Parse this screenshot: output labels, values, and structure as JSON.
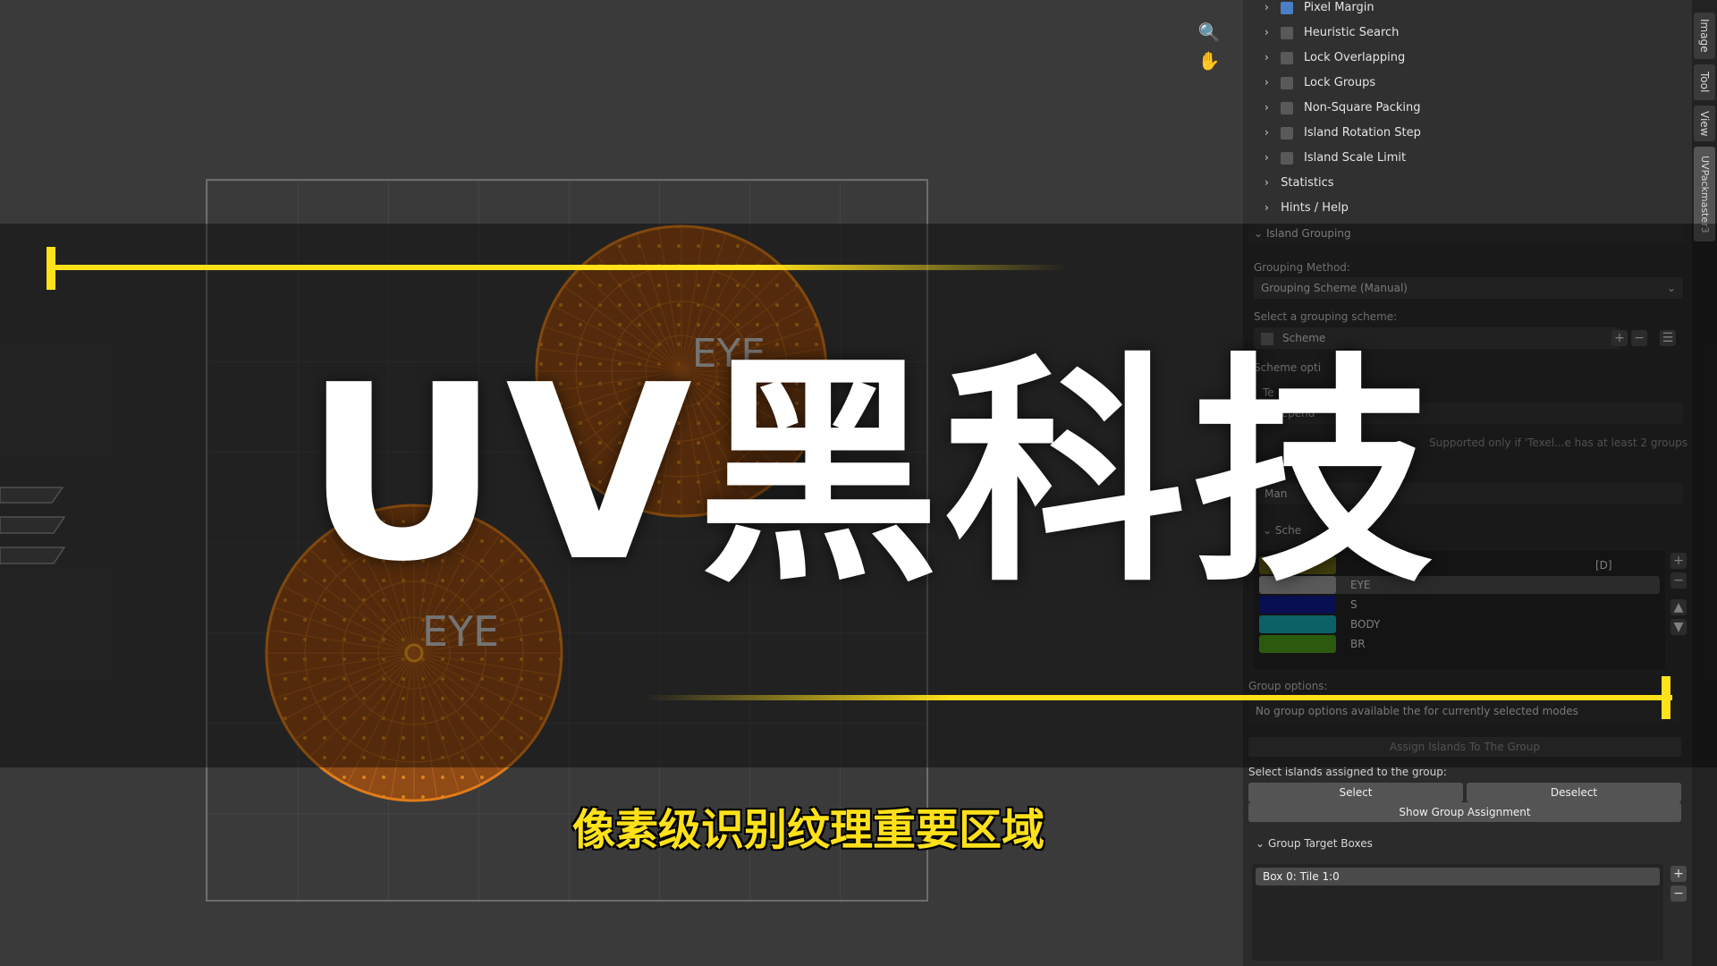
{
  "viewport": {
    "island_label_1": "EYE",
    "island_label_2": "EYE"
  },
  "overlay": {
    "title": "UV黑科技",
    "subtitle": "像素级识别纹理重要区域",
    "accent_color": "#ffe11a"
  },
  "panel": {
    "options": [
      {
        "label": "Pixel Margin",
        "checked": true
      },
      {
        "label": "Heuristic Search",
        "checked": false
      },
      {
        "label": "Lock Overlapping",
        "checked": false
      },
      {
        "label": "Lock Groups",
        "checked": false
      },
      {
        "label": "Non-Square Packing",
        "checked": false
      },
      {
        "label": "Island Rotation Step",
        "checked": false
      },
      {
        "label": "Island Scale Limit",
        "checked": false
      }
    ],
    "statistics_label": "Statistics",
    "hints_label": "Hints / Help",
    "island_grouping": {
      "header": "Island Grouping",
      "grouping_method_label": "Grouping Method:",
      "grouping_method_value": "Grouping Scheme (Manual)",
      "select_scheme_label": "Select a grouping scheme:",
      "scheme_value": "Scheme",
      "scheme_options_label": "Scheme opti",
      "texel_label": "Te",
      "independent_value": "Independ",
      "supported_note": "Supported only if 'Texel...e has at least 2 groups",
      "gro_label": "Gro",
      "man_value": "Man",
      "sche_header": "Sche",
      "groups": [
        {
          "name": "",
          "color": "#6f6a15",
          "tag": "[D]"
        },
        {
          "name": "EYE",
          "color": "#9a9a9a",
          "tag": ""
        },
        {
          "name": "S",
          "color": "#0d1a8c",
          "tag": ""
        },
        {
          "name": "BODY",
          "color": "#14a7b0",
          "tag": ""
        },
        {
          "name": "BR",
          "color": "#4a9b1a",
          "tag": ""
        }
      ],
      "group_options_label": "Group options:",
      "group_options_text": "No group options available the for currently selected modes",
      "assign_button": "Assign Islands To The Group",
      "select_assigned_label": "Select islands assigned to the group:",
      "select_button": "Select",
      "deselect_button": "Deselect",
      "show_assignment_button": "Show Group Assignment"
    },
    "target_boxes": {
      "header": "Group Target Boxes",
      "items": [
        "Box 0: Tile 1:0"
      ]
    }
  },
  "tabs": [
    "Image",
    "Tool",
    "View",
    "UVPackmaster3"
  ],
  "icons": {
    "zoom": "zoom-icon",
    "hand": "hand-pan-icon"
  }
}
